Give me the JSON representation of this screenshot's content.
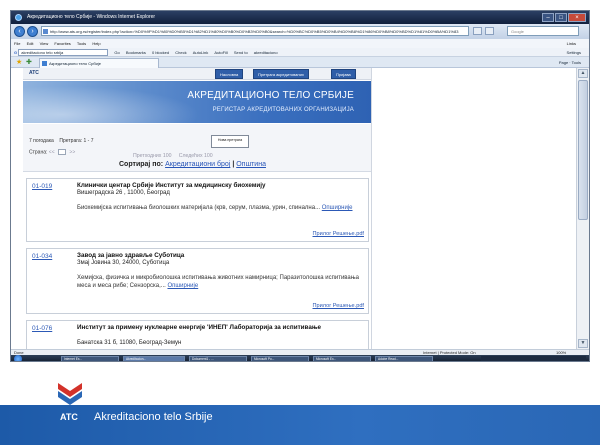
{
  "window": {
    "title": "Акредитационо тело Србије - Windows Internet Explorer",
    "url": "http://www.ats.org.rs/register/index.php?action=%D0%9F%D1%80%D0%B5%D1%82%D1%80%D0%B0%D0%B3%D0%B0&search=%D0%BC%D0%B5%D0%B4%D0%B8%D1%86%D0%B8%D0%BD%D1%81%D0%BA%D1%83",
    "search_placeholder": "Google",
    "menu": [
      "File",
      "Edit",
      "View",
      "Favorites",
      "Tools",
      "Help"
    ],
    "links_label": "Links",
    "toolbar_search_value": "akreditaciono telo srbija",
    "toolbar_items": [
      "Go",
      "Bookmarks",
      "0 blocked",
      "Check",
      "AutoLink",
      "AutoFill",
      "Send to",
      "akreditaciono"
    ],
    "toolbar_settings": "Settings",
    "tab_label": "Акредитационо тело Србије",
    "command_bar": "Page  ·  Tools"
  },
  "site": {
    "small_logo": "ATC",
    "nav": [
      "Насловна",
      "Претрага акредитованих",
      "Пријава"
    ],
    "title": "АКРЕДИТАЦИОНО ТЕЛО СРБИЈЕ",
    "subtitle": "РЕГИСТАР АКРЕДИТОВАНИХ ОРГАНИЗАЦИЈА",
    "found_label": "7 погодака",
    "search_label": "Претрага: 1 - 7",
    "page_label": "Страна:",
    "page_nav_prev": "<<",
    "page_nav_next": ">>",
    "new_search": "Нова претрага",
    "prev_label": "Претходних 100",
    "next_label": "Следећих 100",
    "sort_label": "Сортирај по:",
    "sort_by_number": "Акредитациони број",
    "sort_by_city": "Општина"
  },
  "records": [
    {
      "code": "01-019",
      "name": "Клинички центар Србије Институт за медицинску биохемију",
      "address": "Вишеградска 26 , 11000, Београд",
      "description": "Биохемијска испитивања биолошких материјала (крв, серум, плазма, урин, спинална...",
      "more": "Опширније",
      "attachments": "Прилог Решење.pdf"
    },
    {
      "code": "01-034",
      "name": "Завод за јавно здравље Суботица",
      "address": "Змај Јовина 30, 24000, Суботица",
      "description": "Хемијска, физичка и микробиолошка испитивања животних намирница; Паразитолошка испитивања меса и меса рибе; Сензорска,...",
      "more": "Опширније",
      "attachments": "Прилог Решење.pdf"
    },
    {
      "code": "01-076",
      "name": "Институт за примену нуклеарне енергије 'ИНЕП' Лабораторија за испитивање",
      "address": "Банатска 31 б, 11080, Београд-Земун",
      "description": "",
      "more": "",
      "attachments": ""
    }
  ],
  "status": {
    "left": "Done",
    "zone": "Internet | Protected Mode: On",
    "zoom": "100%"
  },
  "taskbar": [
    "Internet Ex...",
    "Akreditacion...",
    "Dokument1 - ...",
    "Microsoft Po...",
    "Microsoft Ex...",
    "Adobe Read..."
  ],
  "footer": {
    "logo_text": "ATC",
    "org_name": "Akreditaciono telo Srbije"
  },
  "colors": {
    "footer_blue": "#2a67b5",
    "banner_blue": "#3a6fbf",
    "link_blue": "#2c59b6"
  }
}
